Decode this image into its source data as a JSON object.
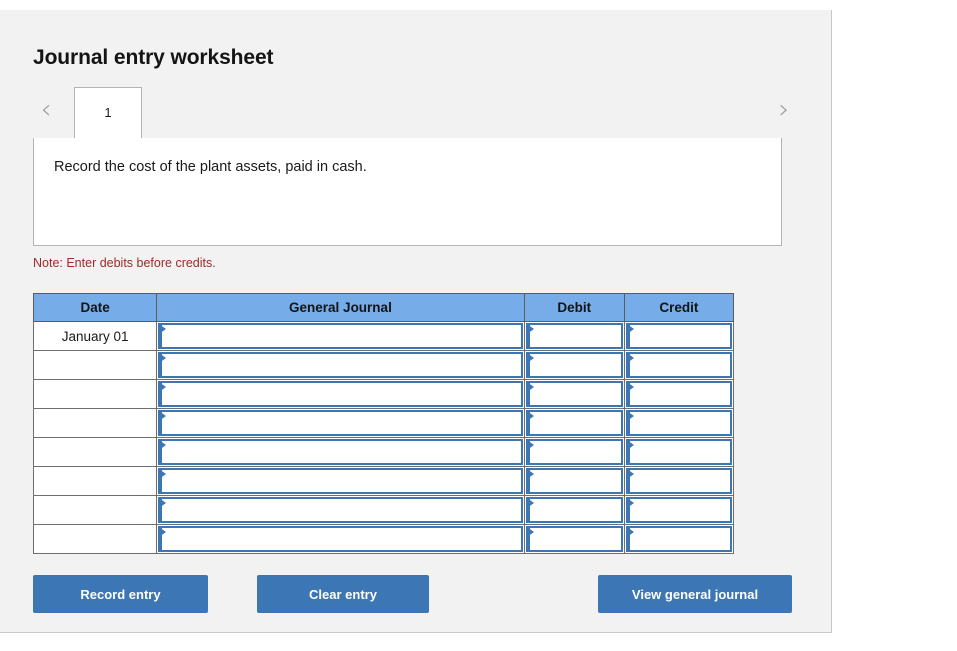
{
  "page": {
    "title": "Journal entry worksheet",
    "note": "Note: Enter debits before credits.",
    "description": "Record the cost of the plant assets, paid in cash."
  },
  "tabs": {
    "prev_arrow": "‹",
    "next_arrow": "›",
    "items": [
      {
        "label": "1",
        "active": true
      }
    ]
  },
  "table": {
    "headers": {
      "date": "Date",
      "general_journal": "General Journal",
      "debit": "Debit",
      "credit": "Credit"
    },
    "rows": [
      {
        "date": "January 01",
        "general_journal": "",
        "debit": "",
        "credit": ""
      },
      {
        "date": "",
        "general_journal": "",
        "debit": "",
        "credit": ""
      },
      {
        "date": "",
        "general_journal": "",
        "debit": "",
        "credit": ""
      },
      {
        "date": "",
        "general_journal": "",
        "debit": "",
        "credit": ""
      },
      {
        "date": "",
        "general_journal": "",
        "debit": "",
        "credit": ""
      },
      {
        "date": "",
        "general_journal": "",
        "debit": "",
        "credit": ""
      },
      {
        "date": "",
        "general_journal": "",
        "debit": "",
        "credit": ""
      },
      {
        "date": "",
        "general_journal": "",
        "debit": "",
        "credit": ""
      }
    ]
  },
  "buttons": {
    "record_entry": "Record entry",
    "clear_entry": "Clear entry",
    "view_general_journal": "View general journal"
  },
  "colors": {
    "panel_background": "#f2f2f2",
    "table_header_blue": "#76ace8",
    "button_blue": "#3c76b5",
    "input_border_blue": "#3c76b5",
    "note_red": "#a02a2a"
  }
}
